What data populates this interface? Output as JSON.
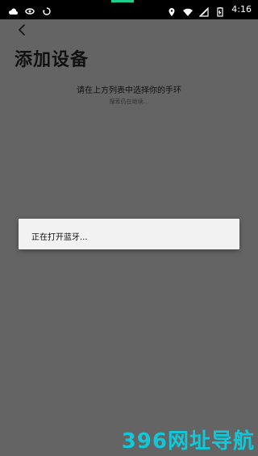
{
  "status_bar": {
    "time": "4:16",
    "left_icons": [
      "cloud-icon",
      "eye-icon",
      "sync-icon"
    ],
    "right_icons": [
      "location-icon",
      "wifi-icon",
      "signal-icon",
      "battery-icon"
    ],
    "accent_color": "#1ccf8b"
  },
  "header": {
    "back_icon": "back-arrow-icon",
    "title": "添加设备"
  },
  "main": {
    "instruction": "请在上方列表中选择你的手环",
    "hint": "搜索仍在继续..."
  },
  "dialog": {
    "message": "正在打开蓝牙..."
  },
  "watermark": {
    "text": "396网址导航",
    "color": "#0fc9d9"
  }
}
